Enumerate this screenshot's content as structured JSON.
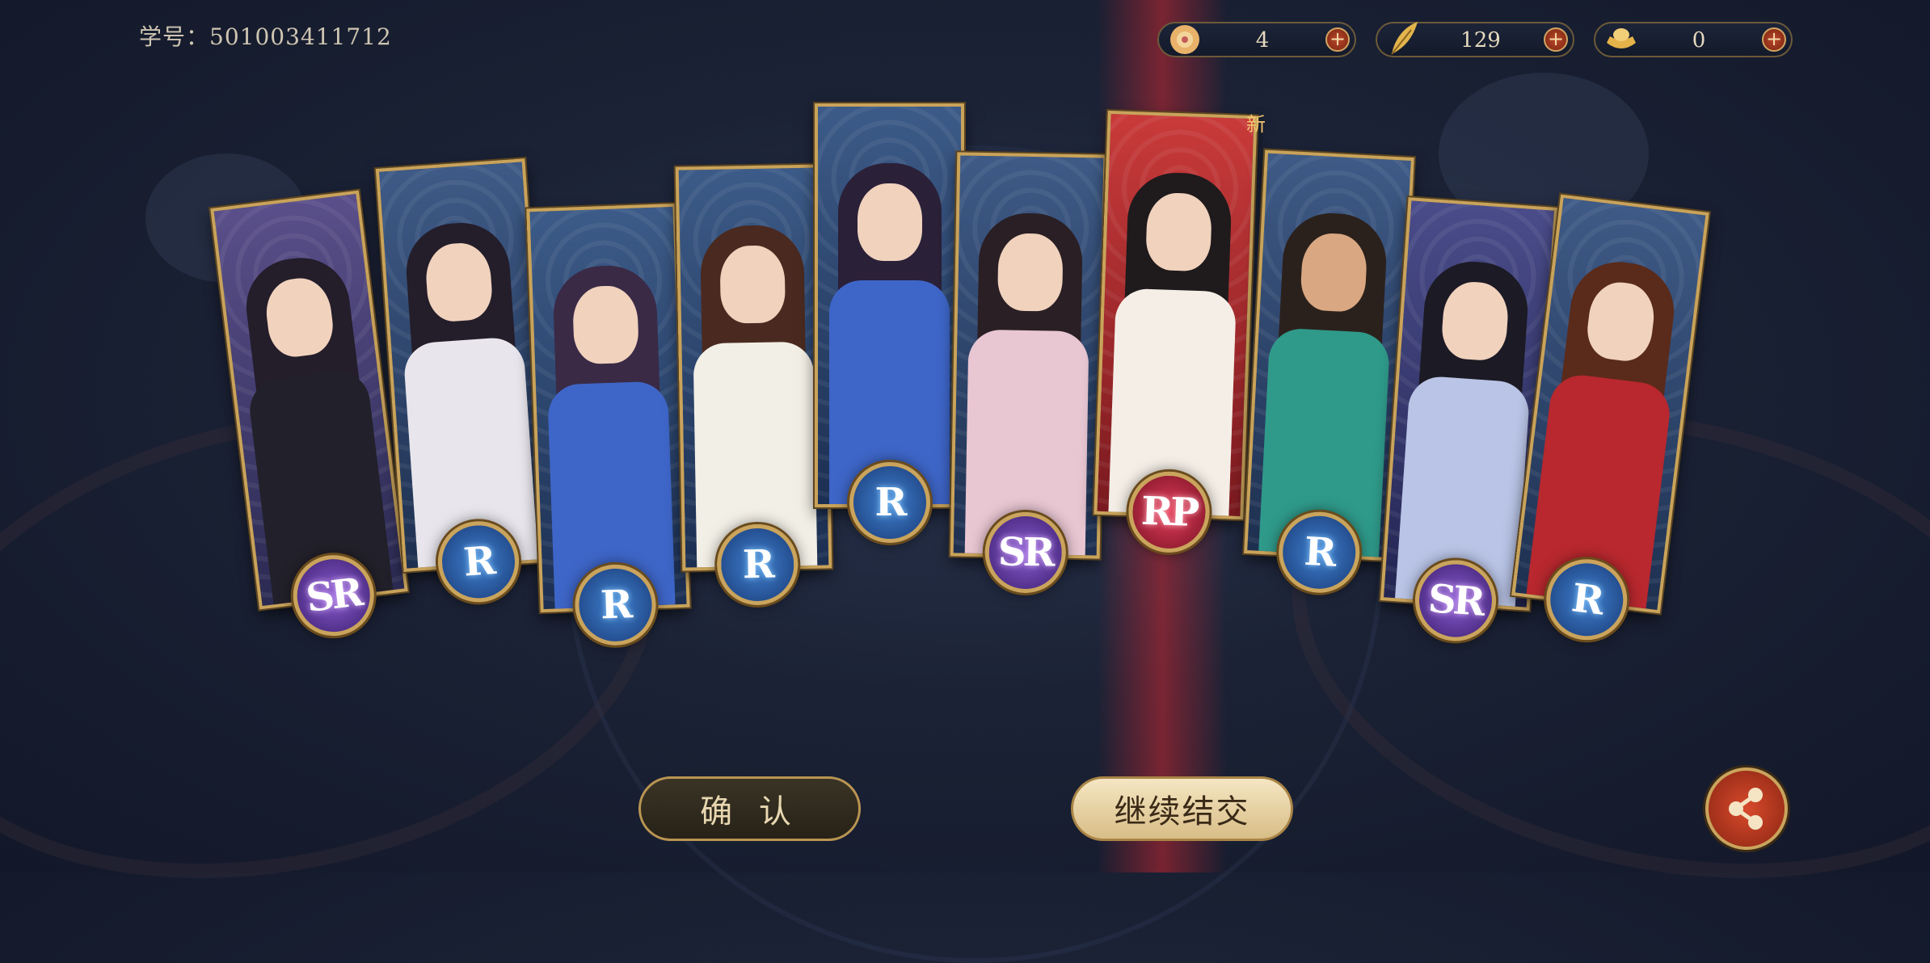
{
  "header": {
    "student_id": "学号：501003411712"
  },
  "currencies": [
    {
      "icon": "lotus-token-icon",
      "value": "4"
    },
    {
      "icon": "gold-feather-icon",
      "value": "129"
    },
    {
      "icon": "gold-ingot-icon",
      "value": "0"
    }
  ],
  "cards": [
    {
      "rarity": "SR"
    },
    {
      "rarity": "R"
    },
    {
      "rarity": "R"
    },
    {
      "rarity": "R"
    },
    {
      "rarity": "R"
    },
    {
      "rarity": "SR"
    },
    {
      "rarity": "RP",
      "new_label": "新"
    },
    {
      "rarity": "R"
    },
    {
      "rarity": "SR"
    },
    {
      "rarity": "R"
    }
  ],
  "buttons": {
    "confirm": "确 认",
    "continue": "继续结交"
  },
  "colors": {
    "frame_gold": "#c9a35a",
    "r_badge": "#2f62b0",
    "sr_badge": "#6a3fb0",
    "rp_badge": "#c8233f"
  }
}
